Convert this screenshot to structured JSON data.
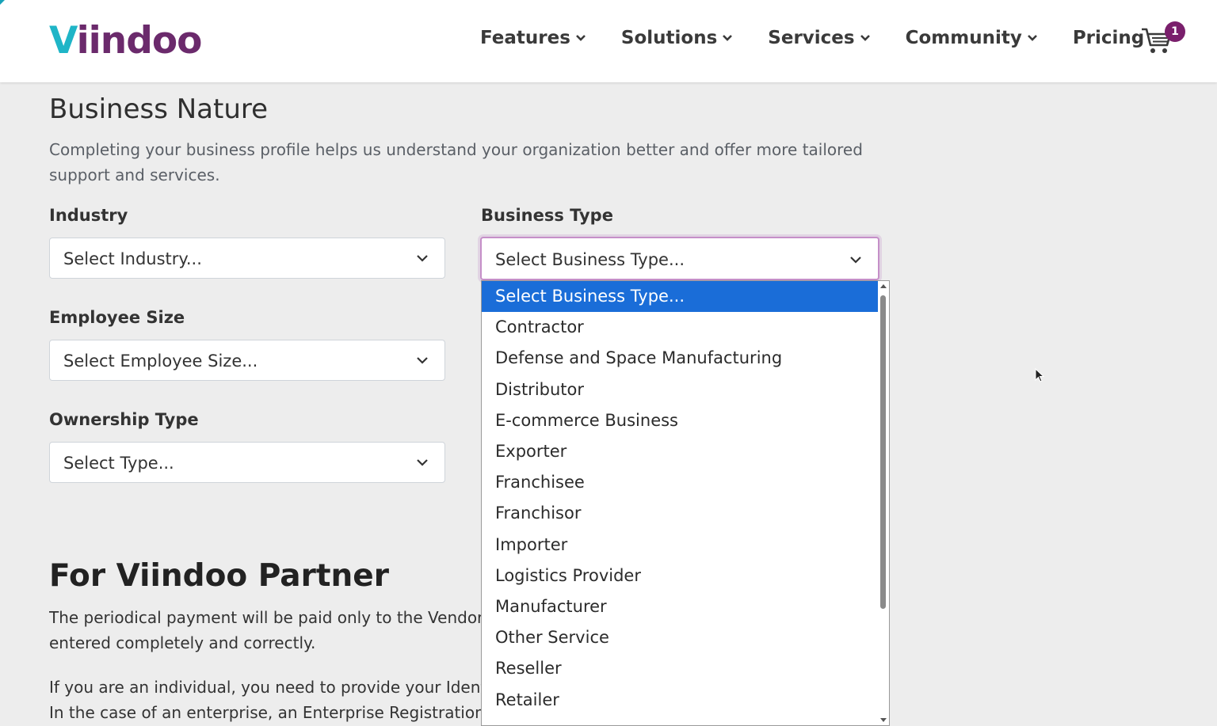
{
  "header": {
    "logo": {
      "first": "V",
      "rest": "iindoo"
    },
    "nav": [
      {
        "label": "Features",
        "dropdown": true
      },
      {
        "label": "Solutions",
        "dropdown": true
      },
      {
        "label": "Services",
        "dropdown": true
      },
      {
        "label": "Community",
        "dropdown": true
      },
      {
        "label": "Pricing",
        "dropdown": false
      }
    ],
    "cart_count": "1"
  },
  "business_nature": {
    "title": "Business Nature",
    "description_line1": "Completing your business profile helps us understand your organization better and offer more tailored",
    "description_line2": "support and services.",
    "fields": {
      "industry": {
        "label": "Industry",
        "value": "Select Industry..."
      },
      "business_type": {
        "label": "Business Type",
        "value": "Select Business Type..."
      },
      "employee_size": {
        "label": "Employee Size",
        "value": "Select Employee Size..."
      },
      "ownership_type": {
        "label": "Ownership Type",
        "value": "Select Type..."
      }
    }
  },
  "business_type_options": {
    "selected_index": 0,
    "items": [
      "Select Business Type...",
      "Contractor",
      "Defense and Space Manufacturing",
      "Distributor",
      "E-commerce Business",
      "Exporter",
      "Franchisee",
      "Franchisor",
      "Importer",
      "Logistics Provider",
      "Manufacturer",
      "Other Service",
      "Reseller",
      "Retailer"
    ]
  },
  "partner": {
    "title": "For Viindoo Partner",
    "line1": "The periodical payment will be paid only to the Vendor",
    "line2": "entered completely and correctly.",
    "line3": "If you are an individual, you need to provide your Ident",
    "line4": "In the case of an enterprise, an Enterprise Registration"
  },
  "colors": {
    "accent_purple": "#6b2a6c",
    "logo_teal": "#1fb5c7",
    "option_selected": "#1a6dd8"
  }
}
